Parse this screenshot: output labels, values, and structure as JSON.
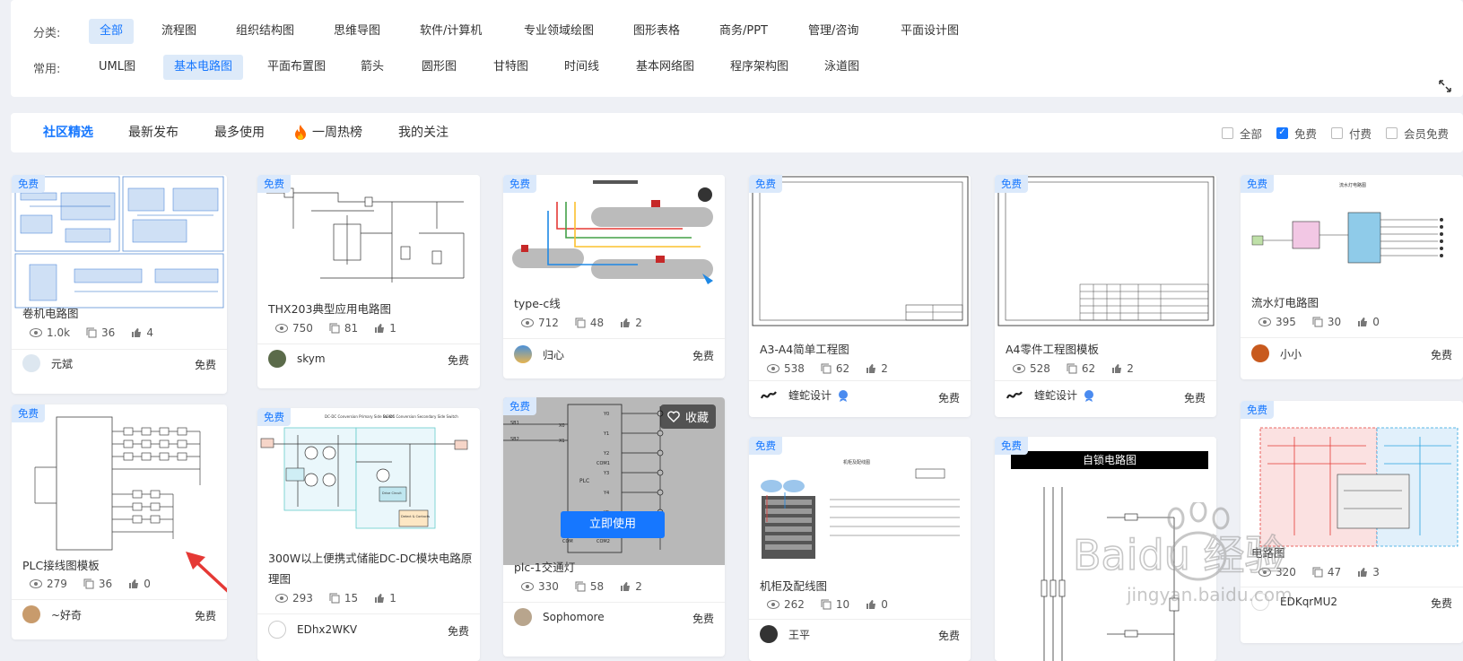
{
  "filters": {
    "category_label": "分类:",
    "categories": [
      "全部",
      "流程图",
      "组织结构图",
      "思维导图",
      "软件/计算机",
      "专业领域绘图",
      "图形表格",
      "商务/PPT",
      "管理/咨询",
      "平面设计图"
    ],
    "common_label": "常用:",
    "common": [
      "UML图",
      "基本电路图",
      "平面布置图",
      "箭头",
      "圆形图",
      "甘特图",
      "时间线",
      "基本网络图",
      "程序架构图",
      "泳道图"
    ]
  },
  "tabs": [
    "社区精选",
    "最新发布",
    "最多使用",
    "一周热榜",
    "我的关注"
  ],
  "checkboxes": [
    {
      "label": "全部",
      "checked": false
    },
    {
      "label": "免费",
      "checked": true
    },
    {
      "label": "付费",
      "checked": false
    },
    {
      "label": "会员免费",
      "checked": false
    }
  ],
  "badge": "免费",
  "cards": [
    {
      "title": "卷机电路图",
      "views": "1.0k",
      "copies": "36",
      "likes": "4",
      "author": "元斌",
      "price": "免费"
    },
    {
      "title": "PLC接线图模板",
      "views": "279",
      "copies": "36",
      "likes": "0",
      "author": "~好奇",
      "price": "免费"
    },
    {
      "title": "THX203典型应用电路图",
      "views": "750",
      "copies": "81",
      "likes": "1",
      "author": "skym",
      "price": "免费"
    },
    {
      "title": "300W以上便携式储能DC-DC模块电路原理图",
      "title_l1": "300W以上便携式储能DC-DC模块电路原",
      "title_l2": "理图",
      "views": "293",
      "copies": "15",
      "likes": "1",
      "author": "EDhx2WKV",
      "price": "免费"
    },
    {
      "title": "type-c线",
      "views": "712",
      "copies": "48",
      "likes": "2",
      "author": "归心",
      "price": "免费"
    },
    {
      "title": "plc-1交通灯",
      "views": "330",
      "copies": "58",
      "likes": "2",
      "author": "Sophomore",
      "price": "免费",
      "fav": "收藏",
      "use": "立即使用"
    },
    {
      "title": "A3-A4简单工程图",
      "views": "538",
      "copies": "62",
      "likes": "2",
      "author": "蝰蛇设计",
      "price": "免费"
    },
    {
      "title": "机柜及配线图",
      "views": "262",
      "copies": "10",
      "likes": "0",
      "author": "王平",
      "price": "免费"
    },
    {
      "title": "A4零件工程图模板",
      "views": "528",
      "copies": "62",
      "likes": "2",
      "author": "蝰蛇设计",
      "price": "免费"
    },
    {
      "title": "自锁电路图",
      "author": "",
      "price": ""
    },
    {
      "title": "流水灯电路图",
      "views": "395",
      "copies": "30",
      "likes": "0",
      "author": "小小",
      "price": "免费"
    },
    {
      "title": "电路图",
      "views": "320",
      "copies": "47",
      "likes": "3",
      "author": "EDKqrMU2",
      "price": "免费"
    }
  ],
  "diagram_text": {
    "self_lock_title": "自锁电路图",
    "cabinet_title": "机柜及配线图",
    "flow_title": "流水灯电路图",
    "dcdc_primary": "DC-DC Conversion Primary Side Switch",
    "dcdc_secondary": "DC-DC Conversion Secondary Side Switch",
    "drive_circuit": "Drive Circuit",
    "detect_contacts": "Detect & Contacts",
    "control_circuit": "Control Circuit",
    "plc_label": "PLC",
    "plc_ports": [
      "Y0",
      "Y1",
      "Y2",
      "Y3",
      "Y4",
      "Y5",
      "COM1",
      "COM2",
      "COM"
    ],
    "plc_inputs": [
      "SB1",
      "SB2",
      "X0",
      "X1"
    ],
    "watermark": "Baidu 经验",
    "watermark_url": "jingyan.baidu.com"
  },
  "colors": {
    "accent": "#1677ff",
    "badge_bg": "#dbe9fb",
    "active_chip_bg": "#ddeaf9",
    "arrow": "#e53935"
  }
}
